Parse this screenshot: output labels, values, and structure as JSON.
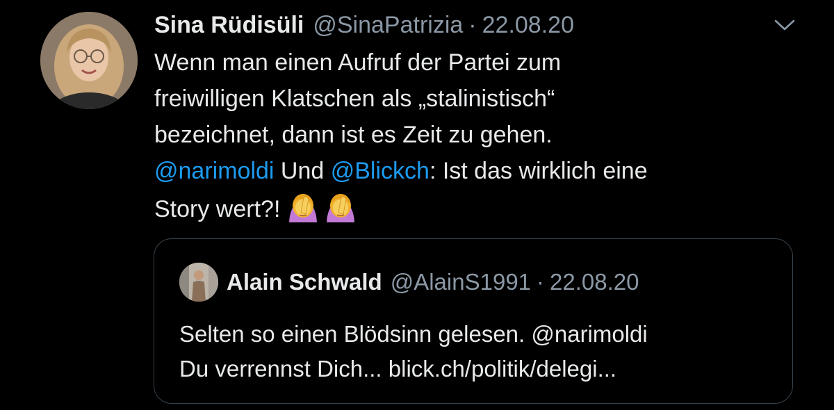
{
  "tweet": {
    "display_name": "Sina Rüdisüli",
    "handle": "@SinaPatrizia",
    "separator": "·",
    "date": "22.08.20",
    "more_icon": "chevron-down-icon",
    "text_part1": "Wenn man einen Aufruf der Partei zum\nfreiwilligen Klatschen als „stalinistisch“\nbezeichnet, dann ist es Zeit zu gehen.\n",
    "mention1": "@narimoldi",
    "text_part2": " Und ",
    "mention2": "@Blickch",
    "text_part3": ": Ist das wirklich eine\nStory wert?!",
    "emoji": [
      "woman-facepalming-icon",
      "woman-facepalming-icon"
    ]
  },
  "quoted_tweet": {
    "display_name": "Alain Schwald",
    "handle": "@AlainS1991",
    "separator": "·",
    "date": "22.08.20",
    "line1": "Selten so einen Blödsinn gelesen. @narimoldi",
    "line2": "Du verrennst Dich... blick.ch/politik/delegi..."
  },
  "colors": {
    "background": "#000000",
    "text": "#e7e9ea",
    "muted": "#8b98a5",
    "link": "#1d9bf0",
    "border": "#38444d"
  }
}
